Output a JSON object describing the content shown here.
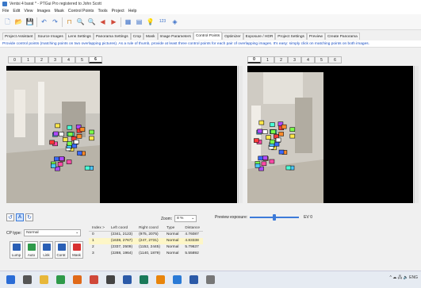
{
  "window": {
    "title": "Ventsi 4 barat * - PTGui Pro registered to John Scott"
  },
  "menu": [
    "File",
    "Edit",
    "View",
    "Images",
    "Mask",
    "Control Points",
    "Tools",
    "Project",
    "Help"
  ],
  "toolbar": {
    "items": [
      {
        "icon": "new-icon",
        "glyph": "🗋",
        "color": "#6a8fd0"
      },
      {
        "icon": "open-icon",
        "glyph": "📂",
        "color": "#d9a43a"
      },
      {
        "icon": "save-icon",
        "glyph": "💾",
        "color": "#3a6fc8"
      },
      {
        "icon": "undo-icon",
        "glyph": "↶",
        "color": "#3a6fc8"
      },
      {
        "icon": "redo-icon",
        "glyph": "↷",
        "color": "#3a6fc8"
      },
      {
        "icon": "optimizer-icon",
        "glyph": "⊓",
        "color": "#d08a2a"
      },
      {
        "icon": "zoom-in-icon",
        "glyph": "🔍",
        "color": "#4a7fd0"
      },
      {
        "icon": "zoom-out-icon",
        "glyph": "🔍",
        "color": "#4a7fd0"
      },
      {
        "icon": "arrow-left-icon",
        "glyph": "◀",
        "color": "#d04a3a"
      },
      {
        "icon": "arrow-right-icon",
        "glyph": "▶",
        "color": "#d04a3a"
      },
      {
        "icon": "panorama-editor-icon",
        "glyph": "▦",
        "color": "#3a6fc8"
      },
      {
        "icon": "grid-icon",
        "glyph": "▤",
        "color": "#3a6fc8"
      },
      {
        "icon": "bulb-icon",
        "glyph": "💡",
        "color": "#e0b020"
      },
      {
        "icon": "numbers-icon",
        "glyph": "123",
        "color": "#3a6fc8"
      },
      {
        "icon": "compass-icon",
        "glyph": "◈",
        "color": "#3a6fc8"
      }
    ]
  },
  "tabs": [
    "Project Assistant",
    "Source Images",
    "Lens Settings",
    "Panorama Settings",
    "Crop",
    "Mask",
    "Image Parameters",
    "Control Points",
    "Optimizer",
    "Exposure / HDR",
    "Project Settings",
    "Preview",
    "Create Panorama"
  ],
  "active_tab": "Control Points",
  "info_text": "Provide control points (matching points on two overlapping pictures). As a rule of thumb, provide at least three control points for each pair of overlapping images. It's easy: simply click on matching points on both images.",
  "left_image_tabs": [
    "0",
    "1",
    "2",
    "3",
    "4",
    "5",
    "6"
  ],
  "left_active": "6",
  "right_image_tabs": [
    "0",
    "1",
    "2",
    "3",
    "4",
    "5",
    "6"
  ],
  "right_active": "0",
  "view_controls": {
    "zoom_label": "Zoom:",
    "zoom_value": "8 %",
    "preview_exposure_label": "Preview exposure:",
    "ev_value": "EV 0"
  },
  "cp_type": {
    "label": "CP type:",
    "value": "Normal"
  },
  "cp_buttons": [
    "Lump",
    "Auto",
    "Link",
    "Contr.",
    "Mask"
  ],
  "table": {
    "headers": [
      "Index >",
      "Left coord",
      "Right coord",
      "Type",
      "Distance"
    ],
    "rows": [
      [
        "0",
        "(2341, 2123)",
        "(975, 2075)",
        "Normal",
        "4.76087"
      ],
      [
        "1",
        "(1638, 2767)",
        "(247, 2731)",
        "Normal",
        "4.83338"
      ],
      [
        "2",
        "(2337, 2509)",
        "(1152, 2445)",
        "Normal",
        "5.79637"
      ],
      [
        "3",
        "(2288, 1964)",
        "(1140, 1879)",
        "Normal",
        "5.55892"
      ]
    ],
    "selected_row": 1
  },
  "taskbar": {
    "apps": [
      {
        "icon": "start-icon",
        "color": "#2a6cd6"
      },
      {
        "icon": "task-view-icon",
        "color": "#555"
      },
      {
        "icon": "file-explorer-icon",
        "color": "#e7b73a"
      },
      {
        "icon": "app-green-icon",
        "color": "#2e9a4a"
      },
      {
        "icon": "app-orange-icon",
        "color": "#e06a1a"
      },
      {
        "icon": "app-photo-icon",
        "color": "#d0483a"
      },
      {
        "icon": "app-video-icon",
        "color": "#444"
      },
      {
        "icon": "app-word-icon",
        "color": "#2b5aa8"
      },
      {
        "icon": "app-image-icon",
        "color": "#1a7a5a"
      },
      {
        "icon": "vlc-icon",
        "color": "#e8850c"
      },
      {
        "icon": "app-blue-icon",
        "color": "#2a7ad6"
      },
      {
        "icon": "app-docs-icon",
        "color": "#2b5aa8"
      },
      {
        "icon": "ptgui-icon",
        "color": "#777"
      }
    ],
    "tray_text": "^ ☁ 🖧 🔈 ENG"
  }
}
